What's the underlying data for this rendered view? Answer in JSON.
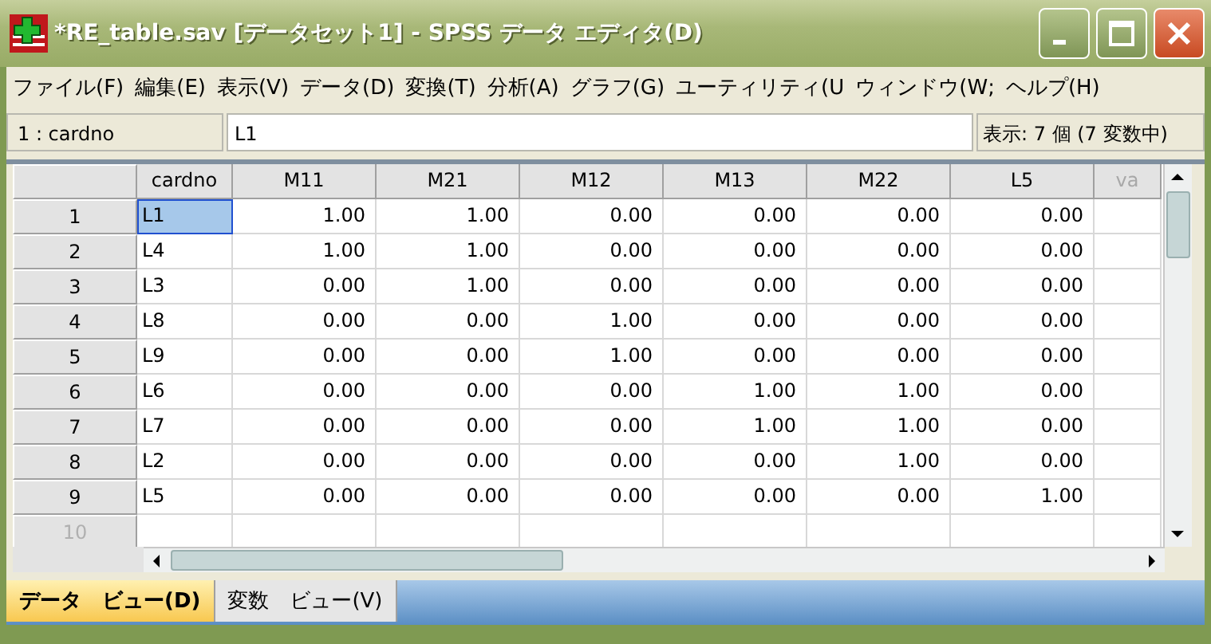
{
  "window": {
    "title": "*RE_table.sav [データセット1] - SPSS データ エディタ(D)"
  },
  "menu": [
    "ファイル(F)",
    "編集(E)",
    "表示(V)",
    "データ(D)",
    "変換(T)",
    "分析(A)",
    "グラフ(G)",
    "ユーティリティ(U",
    "ウィンドウ(W;",
    "ヘルプ(H)"
  ],
  "cell_editor": {
    "reference": "1 : cardno",
    "value": "L1",
    "status": "表示: 7 個 (7 変数中)"
  },
  "table": {
    "columns": [
      {
        "label": "cardno",
        "disabled": false
      },
      {
        "label": "M11",
        "disabled": false
      },
      {
        "label": "M21",
        "disabled": false
      },
      {
        "label": "M12",
        "disabled": false
      },
      {
        "label": "M13",
        "disabled": false
      },
      {
        "label": "M22",
        "disabled": false
      },
      {
        "label": "L5",
        "disabled": false
      },
      {
        "label": "va",
        "disabled": true
      }
    ],
    "rows": [
      {
        "label": "1",
        "disabled": false,
        "cells": [
          {
            "text": "L1",
            "selected": true
          },
          {
            "text": "1.00",
            "selected": false
          },
          {
            "text": "1.00",
            "selected": false
          },
          {
            "text": "0.00",
            "selected": false
          },
          {
            "text": "0.00",
            "selected": false
          },
          {
            "text": "0.00",
            "selected": false
          },
          {
            "text": "0.00",
            "selected": false
          }
        ]
      },
      {
        "label": "2",
        "disabled": false,
        "cells": [
          {
            "text": "L4",
            "selected": false
          },
          {
            "text": "1.00",
            "selected": false
          },
          {
            "text": "1.00",
            "selected": false
          },
          {
            "text": "0.00",
            "selected": false
          },
          {
            "text": "0.00",
            "selected": false
          },
          {
            "text": "0.00",
            "selected": false
          },
          {
            "text": "0.00",
            "selected": false
          }
        ]
      },
      {
        "label": "3",
        "disabled": false,
        "cells": [
          {
            "text": "L3",
            "selected": false
          },
          {
            "text": "0.00",
            "selected": false
          },
          {
            "text": "1.00",
            "selected": false
          },
          {
            "text": "0.00",
            "selected": false
          },
          {
            "text": "0.00",
            "selected": false
          },
          {
            "text": "0.00",
            "selected": false
          },
          {
            "text": "0.00",
            "selected": false
          }
        ]
      },
      {
        "label": "4",
        "disabled": false,
        "cells": [
          {
            "text": "L8",
            "selected": false
          },
          {
            "text": "0.00",
            "selected": false
          },
          {
            "text": "0.00",
            "selected": false
          },
          {
            "text": "1.00",
            "selected": false
          },
          {
            "text": "0.00",
            "selected": false
          },
          {
            "text": "0.00",
            "selected": false
          },
          {
            "text": "0.00",
            "selected": false
          }
        ]
      },
      {
        "label": "5",
        "disabled": false,
        "cells": [
          {
            "text": "L9",
            "selected": false
          },
          {
            "text": "0.00",
            "selected": false
          },
          {
            "text": "0.00",
            "selected": false
          },
          {
            "text": "1.00",
            "selected": false
          },
          {
            "text": "0.00",
            "selected": false
          },
          {
            "text": "0.00",
            "selected": false
          },
          {
            "text": "0.00",
            "selected": false
          }
        ]
      },
      {
        "label": "6",
        "disabled": false,
        "cells": [
          {
            "text": "L6",
            "selected": false
          },
          {
            "text": "0.00",
            "selected": false
          },
          {
            "text": "0.00",
            "selected": false
          },
          {
            "text": "0.00",
            "selected": false
          },
          {
            "text": "1.00",
            "selected": false
          },
          {
            "text": "1.00",
            "selected": false
          },
          {
            "text": "0.00",
            "selected": false
          }
        ]
      },
      {
        "label": "7",
        "disabled": false,
        "cells": [
          {
            "text": "L7",
            "selected": false
          },
          {
            "text": "0.00",
            "selected": false
          },
          {
            "text": "0.00",
            "selected": false
          },
          {
            "text": "0.00",
            "selected": false
          },
          {
            "text": "1.00",
            "selected": false
          },
          {
            "text": "1.00",
            "selected": false
          },
          {
            "text": "0.00",
            "selected": false
          }
        ]
      },
      {
        "label": "8",
        "disabled": false,
        "cells": [
          {
            "text": "L2",
            "selected": false
          },
          {
            "text": "0.00",
            "selected": false
          },
          {
            "text": "0.00",
            "selected": false
          },
          {
            "text": "0.00",
            "selected": false
          },
          {
            "text": "0.00",
            "selected": false
          },
          {
            "text": "1.00",
            "selected": false
          },
          {
            "text": "0.00",
            "selected": false
          }
        ]
      },
      {
        "label": "9",
        "disabled": false,
        "cells": [
          {
            "text": "L5",
            "selected": false
          },
          {
            "text": "0.00",
            "selected": false
          },
          {
            "text": "0.00",
            "selected": false
          },
          {
            "text": "0.00",
            "selected": false
          },
          {
            "text": "0.00",
            "selected": false
          },
          {
            "text": "0.00",
            "selected": false
          },
          {
            "text": "1.00",
            "selected": false
          }
        ]
      },
      {
        "label": "10",
        "disabled": true,
        "cells": []
      }
    ]
  },
  "tabs": [
    {
      "label": "データ　ビュー(D)",
      "selected": true
    },
    {
      "label": "変数　ビュー(V)",
      "selected": false
    }
  ]
}
